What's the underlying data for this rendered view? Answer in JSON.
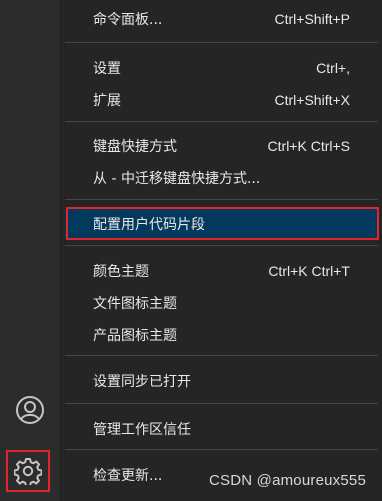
{
  "menu": {
    "groups": [
      [
        {
          "label": "命令面板...",
          "shortcut": "Ctrl+Shift+P"
        }
      ],
      [
        {
          "label": "设置",
          "shortcut": "Ctrl+,"
        },
        {
          "label": "扩展",
          "shortcut": "Ctrl+Shift+X"
        }
      ],
      [
        {
          "label": "键盘快捷方式",
          "shortcut": "Ctrl+K Ctrl+S"
        },
        {
          "label": "从 - 中迁移键盘快捷方式...",
          "shortcut": ""
        }
      ],
      [
        {
          "label": "配置用户代码片段",
          "shortcut": "",
          "selected": true
        }
      ],
      [
        {
          "label": "颜色主题",
          "shortcut": "Ctrl+K Ctrl+T"
        },
        {
          "label": "文件图标主题",
          "shortcut": ""
        },
        {
          "label": "产品图标主题",
          "shortcut": ""
        }
      ],
      [
        {
          "label": "设置同步已打开",
          "shortcut": ""
        }
      ],
      [
        {
          "label": "管理工作区信任",
          "shortcut": ""
        }
      ],
      [
        {
          "label": "检查更新...",
          "shortcut": ""
        }
      ]
    ]
  },
  "activity_bar": {
    "icons": [
      "account-icon",
      "gear-icon"
    ]
  },
  "watermark": "CSDN @amoureux555",
  "colors": {
    "menu_bg": "#252526",
    "selected_bg": "#04395e",
    "highlight_border": "#e0252b",
    "text": "#e8e8e8"
  }
}
